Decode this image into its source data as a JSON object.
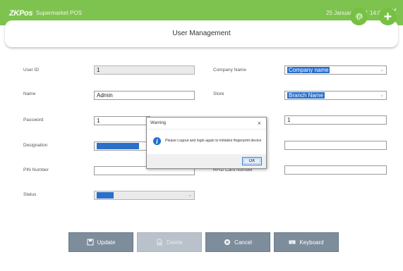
{
  "topbar": {
    "logo": "ZKPos",
    "app_title": "Supermarket POS",
    "datetime": "25 January 2021 14:00",
    "close_label": "X",
    "color": "#7ec34f"
  },
  "header": {
    "title": "User Management",
    "add_label": "+"
  },
  "form": {
    "user_id": {
      "label": "User ID",
      "value": "1"
    },
    "name": {
      "label": "Name",
      "value": "Admin"
    },
    "password": {
      "label": "Password",
      "value": "1"
    },
    "designation": {
      "label": "Designation",
      "value": ""
    },
    "pin_number": {
      "label": "PIN Number",
      "value": ""
    },
    "status": {
      "label": "Status",
      "value": ""
    },
    "company_name": {
      "label": "Company Name",
      "value": "Company name"
    },
    "store": {
      "label": "Store",
      "value": "Branch Name"
    },
    "field_right_3": {
      "value": "1"
    },
    "field_right_4": {
      "value": ""
    },
    "rfid_card_number": {
      "label": "RFID Card Number",
      "value": ""
    }
  },
  "buttons": {
    "update": "Update",
    "delete": "Delete",
    "cancel": "Cancel",
    "keyboard": "Keyboard"
  },
  "dialog": {
    "title": "Warning",
    "close_label": "×",
    "message": "Please Logout and login again to initialize fingerprint device",
    "ok_label": "OK"
  },
  "colors": {
    "accent_green": "#78c043",
    "selection_blue": "#2a6fc9",
    "button_gray": "#7d8d9b",
    "info_blue": "#1f6fd0"
  },
  "icons": [
    "fingerprint-icon",
    "plus-icon",
    "save-icon",
    "delete-icon",
    "cancel-icon",
    "keyboard-icon",
    "info-icon",
    "chevron-down-icon"
  ]
}
